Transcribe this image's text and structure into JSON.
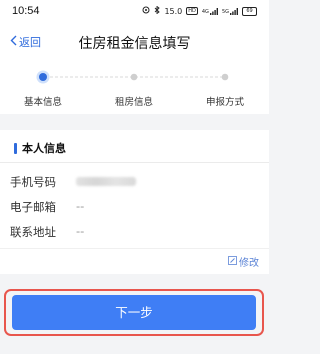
{
  "status_bar": {
    "time": "10:54",
    "icons": [
      "signal-icon",
      "bluetooth-icon",
      "speed-icon",
      "hd-icon",
      "4g-signal-icon",
      "5g-signal-icon",
      "battery-icon"
    ],
    "net_speed": "15.0",
    "hd": "HD",
    "signal_a": "4G",
    "signal_b": "5G",
    "battery": "69"
  },
  "nav": {
    "back_label": "返回",
    "title": "住房租金信息填写"
  },
  "steps": {
    "items": [
      {
        "label": "基本信息",
        "active": true
      },
      {
        "label": "租房信息",
        "active": false
      },
      {
        "label": "申报方式",
        "active": false
      }
    ]
  },
  "personal": {
    "section_title": "本人信息",
    "fields": [
      {
        "label": "手机号码",
        "value": ""
      },
      {
        "label": "电子邮箱",
        "value": "--"
      },
      {
        "label": "联系地址",
        "value": "--"
      }
    ],
    "edit_label": "修改"
  },
  "next_button": {
    "label": "下一步"
  },
  "colors": {
    "accent": "#2f6bdc",
    "button": "#3f7ef5",
    "highlight_border": "#e8564d"
  }
}
